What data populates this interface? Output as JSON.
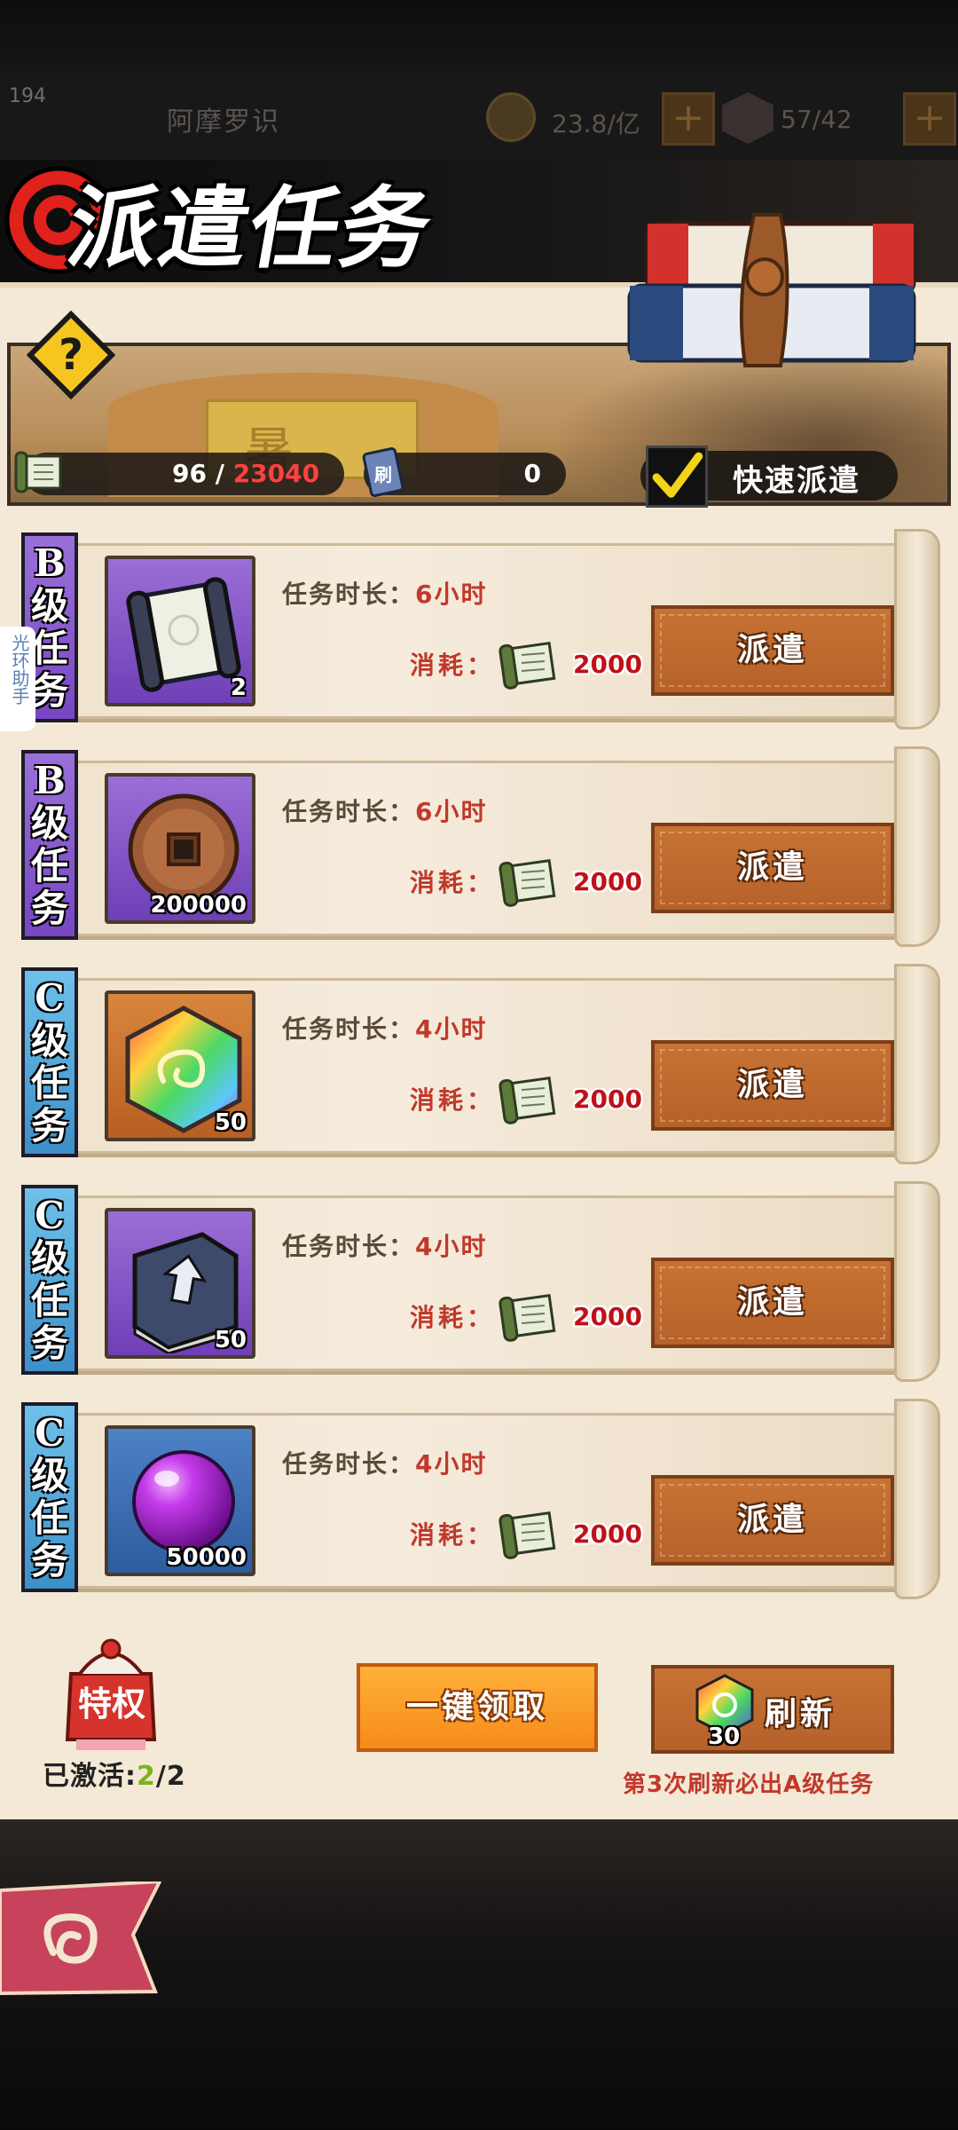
{
  "header": {
    "level": "194",
    "player_name": "阿摩罗识",
    "coins": "23.8/亿",
    "gems": "57/42",
    "plus": "+"
  },
  "title": "派遣任务",
  "banner": {
    "board_char": "暑",
    "scroll_count": "96",
    "scroll_separator": "/",
    "scroll_max": "23040",
    "refresh_tokens": "0",
    "refresh_token_label": "刷",
    "quick_dispatch": "快速派遣"
  },
  "labels": {
    "duration": "任务时长：",
    "cost": "消耗：",
    "dispatch": "派遣"
  },
  "missions": [
    {
      "grade": [
        "B",
        "级",
        "任",
        "务"
      ],
      "grade_type": "b",
      "reward": "scroll-icon",
      "reward_qty": "2",
      "duration": "6小时",
      "cost": "2000"
    },
    {
      "grade": [
        "B",
        "级",
        "任",
        "务"
      ],
      "grade_type": "b",
      "reward": "copper-coin-icon",
      "reward_qty": "200000",
      "duration": "6小时",
      "cost": "2000"
    },
    {
      "grade": [
        "C",
        "级",
        "任",
        "务"
      ],
      "grade_type": "c",
      "reward": "rainbow-gem-icon",
      "reward_qty": "50",
      "duration": "4小时",
      "cost": "2000"
    },
    {
      "grade": [
        "C",
        "级",
        "任",
        "务"
      ],
      "grade_type": "c",
      "reward": "exp-book-icon",
      "reward_qty": "50",
      "duration": "4小时",
      "cost": "2000"
    },
    {
      "grade": [
        "C",
        "级",
        "任",
        "务"
      ],
      "grade_type": "c",
      "reward": "purple-orb-icon",
      "reward_qty": "50000",
      "duration": "4小时",
      "cost": "2000"
    }
  ],
  "helper": "光环助手",
  "footer": {
    "privilege": "特权",
    "activated_label": "已激活:",
    "activated_value": "2",
    "activated_total": "/2",
    "claim_all": "一键领取",
    "refresh": "刷新",
    "refresh_cost": "30",
    "refresh_note": "第3次刷新必出A级任务"
  },
  "colors": {
    "grade_b": "#7747c3",
    "grade_c": "#3d8fc8",
    "dispatch_button": "#b6612a",
    "claim_button": "#f58a1a",
    "highlight_red": "#c0392b",
    "activated_green": "#7bb320"
  }
}
